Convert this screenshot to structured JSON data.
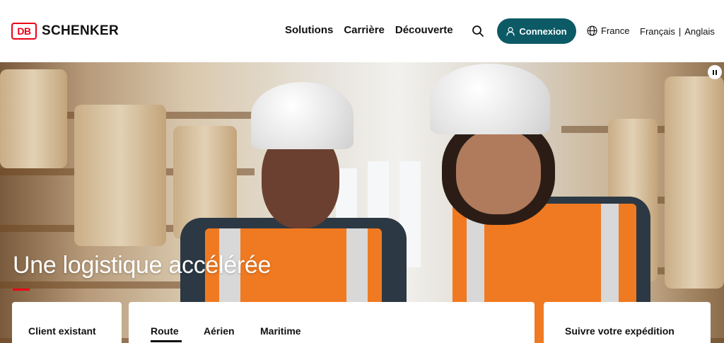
{
  "brand": {
    "logo_mark": "DB",
    "logo_text": "SCHENKER",
    "accent_color": "#ec0016",
    "primary_color": "#0c5a66"
  },
  "nav": {
    "items": [
      {
        "label": "Solutions"
      },
      {
        "label": "Carrière"
      },
      {
        "label": "Découverte"
      }
    ],
    "search_icon": "search-icon"
  },
  "login": {
    "label": "Connexion",
    "icon": "user-icon"
  },
  "region": {
    "label": "France",
    "icon": "globe-icon"
  },
  "languages": {
    "items": [
      "Français",
      "Anglais"
    ],
    "separator": "|"
  },
  "hero": {
    "title": "Une logistique accélérée",
    "pause_icon": "pause-icon"
  },
  "cards": {
    "client": {
      "title": "Client existant"
    },
    "tabs": [
      {
        "label": "Route",
        "active": true
      },
      {
        "label": "Aérien",
        "active": false
      },
      {
        "label": "Maritime",
        "active": false
      }
    ],
    "track": {
      "title": "Suivre votre expédition"
    }
  }
}
